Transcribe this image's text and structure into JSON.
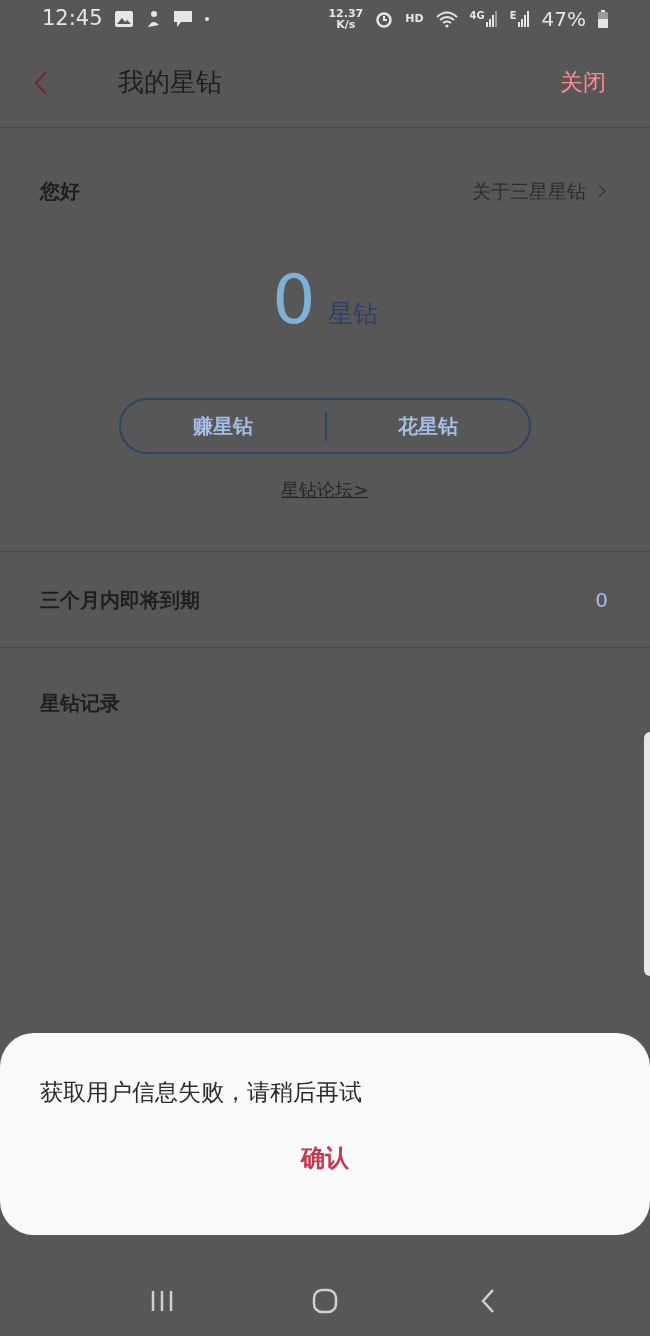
{
  "status_bar": {
    "time": "12:45",
    "speed_value": "12.37",
    "speed_unit": "K/s",
    "hd": "HD",
    "network_4g": "4G",
    "network_e": "E",
    "battery": "47%"
  },
  "header": {
    "title": "我的星钻",
    "close": "关闭"
  },
  "summary": {
    "greeting": "您好",
    "about_link": "关于三星星钻",
    "amount": "0",
    "unit": "星钻",
    "actions": [
      "赚星钻",
      "花星钻"
    ],
    "forum_link": "星钻论坛>"
  },
  "expiring": {
    "label": "三个月内即将到期",
    "value": "0"
  },
  "records": {
    "title": "星钻记录"
  },
  "dialog": {
    "message": "获取用户信息失败，请稍后再试",
    "confirm": "确认"
  }
}
